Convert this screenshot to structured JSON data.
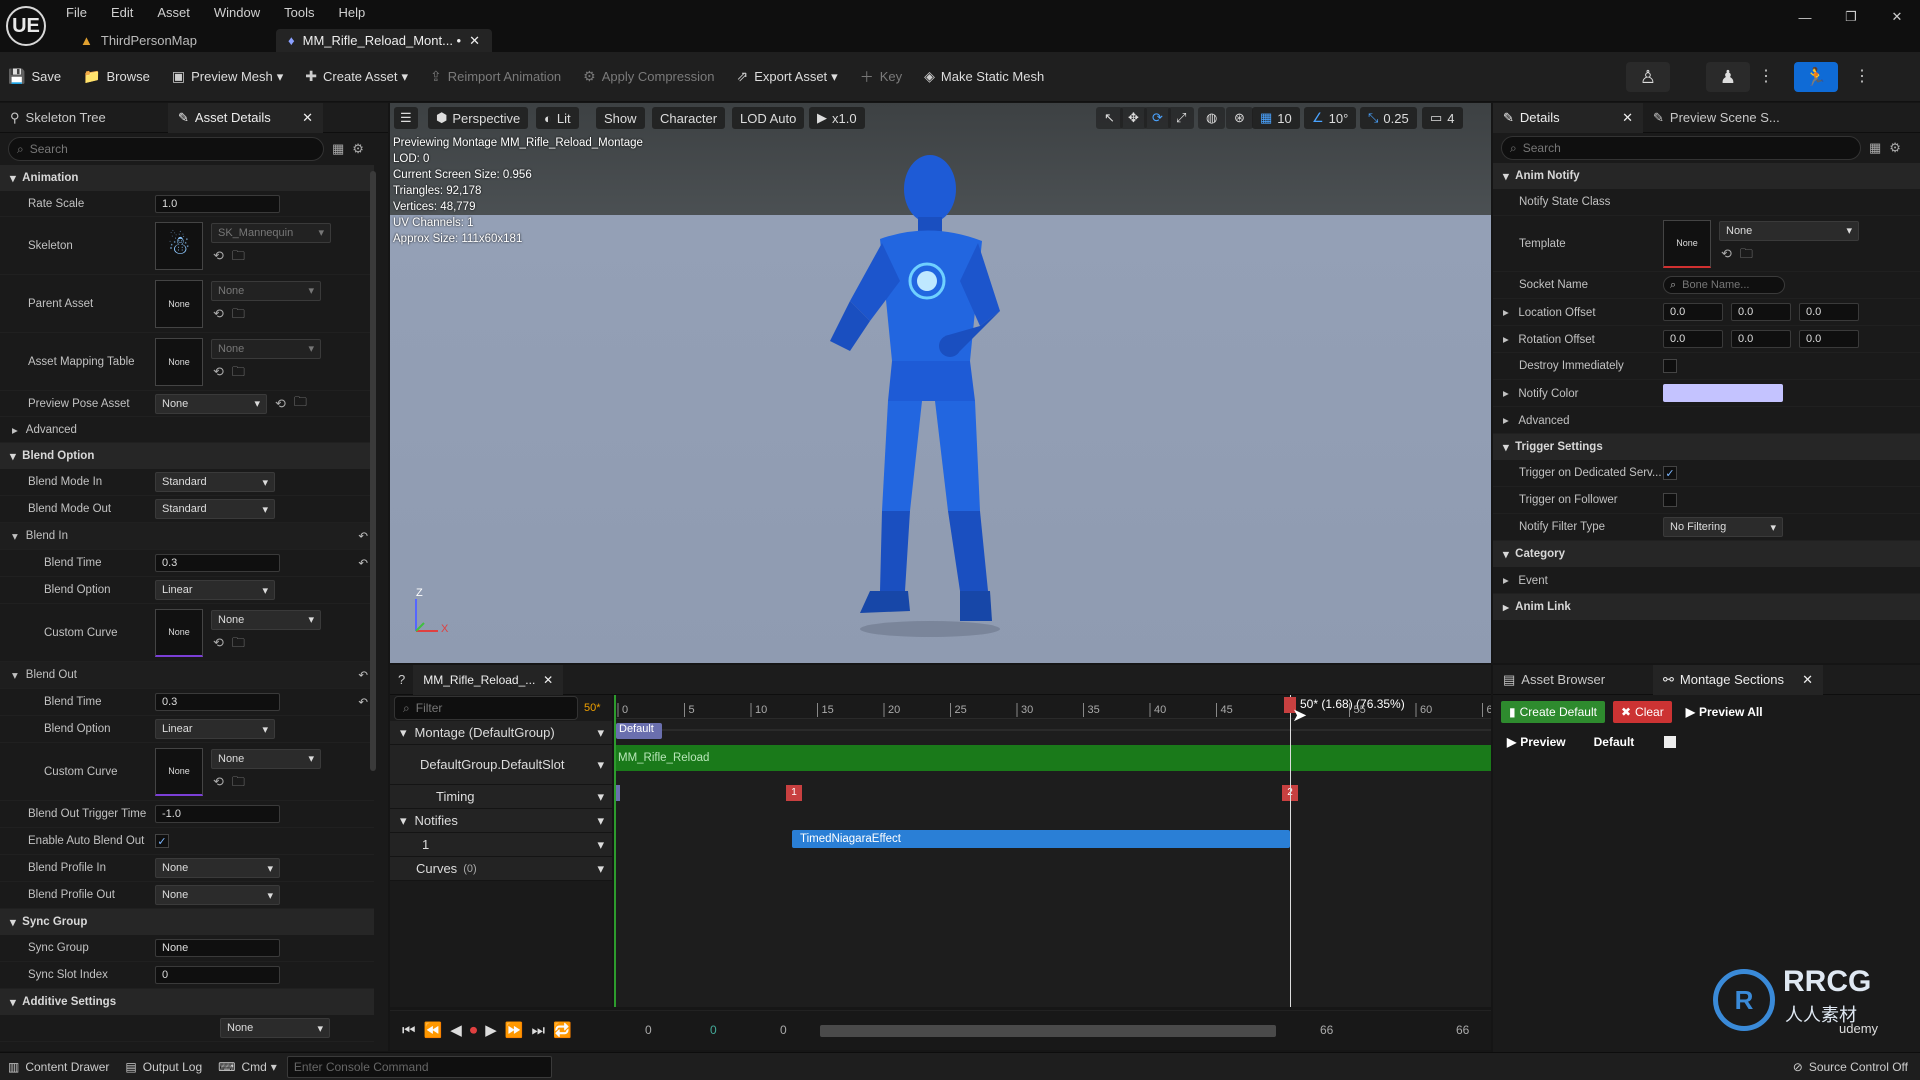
{
  "app": {
    "logo": "UE"
  },
  "menu": [
    "File",
    "Edit",
    "Asset",
    "Window",
    "Tools",
    "Help"
  ],
  "tabs": [
    {
      "label": "ThirdPersonMap",
      "icon": "map-icon"
    },
    {
      "label": "MM_Rifle_Reload_Mont... •",
      "icon": "montage-icon"
    }
  ],
  "toolbar": {
    "save": "Save",
    "browse": "Browse",
    "preview_mesh": "Preview Mesh",
    "create_asset": "Create Asset",
    "reimport": "Reimport Animation",
    "apply_compression": "Apply Compression",
    "export_asset": "Export Asset",
    "key": "Key",
    "make_static_mesh": "Make Static Mesh"
  },
  "left": {
    "tab1": "Skeleton Tree",
    "tab2": "Asset Details",
    "search_placeholder": "Search",
    "cat_animation": "Animation",
    "rate_scale_label": "Rate Scale",
    "rate_scale": "1.0",
    "skeleton_label": "Skeleton",
    "skeleton_value": "SK_Mannequin",
    "parent_asset_label": "Parent Asset",
    "none": "None",
    "asset_mapping_label": "Asset Mapping Table",
    "preview_pose_label": "Preview Pose Asset",
    "advanced": "Advanced",
    "cat_blend_option": "Blend Option",
    "blend_mode_in_label": "Blend Mode In",
    "blend_mode_in": "Standard",
    "blend_mode_out_label": "Blend Mode Out",
    "blend_mode_out": "Standard",
    "blend_in": "Blend In",
    "blend_time_label": "Blend Time",
    "blend_in_time": "0.3",
    "blend_option_label": "Blend Option",
    "blend_in_option": "Linear",
    "custom_curve_label": "Custom Curve",
    "blend_out": "Blend Out",
    "blend_out_time": "0.3",
    "blend_out_option": "Linear",
    "blend_out_trigger_label": "Blend Out Trigger Time",
    "blend_out_trigger": "-1.0",
    "enable_auto_label": "Enable Auto Blend Out",
    "blend_profile_in_label": "Blend Profile In",
    "blend_profile_out_label": "Blend Profile Out",
    "cat_sync_group": "Sync Group",
    "sync_group_label": "Sync Group",
    "sync_slot_label": "Sync Slot Index",
    "sync_slot": "0",
    "cat_additive": "Additive Settings"
  },
  "viewport": {
    "perspective": "Perspective",
    "lit": "Lit",
    "show": "Show",
    "character": "Character",
    "lod": "LOD Auto",
    "speed": "x1.0",
    "grid": "10",
    "angle": "10°",
    "scale": "0.25",
    "cam": "4",
    "info": [
      "Previewing Montage MM_Rifle_Reload_Montage",
      "LOD: 0",
      "Current Screen Size: 0.956",
      "Triangles: 92,178",
      "Vertices: 48,779",
      "UV Channels: 1",
      "Approx Size: 111x60x181"
    ],
    "axis_z": "Z",
    "axis_x": "X"
  },
  "timeline": {
    "tab": "MM_Rifle_Reload_...",
    "filter_placeholder": "Filter",
    "frame": "50*",
    "ticks": [
      "0",
      "5",
      "10",
      "15",
      "20",
      "25",
      "30",
      "35",
      "40",
      "45",
      "55",
      "60",
      "6"
    ],
    "playhead_label": "50* (1.68) (76.35%)",
    "montage": "Montage (DefaultGroup)",
    "default_section": "Default",
    "slot": "DefaultGroup.DefaultSlot",
    "slot_clip": "MM_Rifle_Reload",
    "timing": "Timing",
    "timing_markers": [
      "1",
      "2"
    ],
    "notifies": "Notifies",
    "notify_track": "1",
    "notify_name": "TimedNiagaraEffect",
    "curves": "Curves",
    "curves_count": "(0)",
    "bottom_vals": [
      "0",
      "0",
      "0",
      "66",
      "66"
    ]
  },
  "right": {
    "tab1": "Details",
    "tab2": "Preview Scene S...",
    "search_placeholder": "Search",
    "cat_anim_notify": "Anim Notify",
    "notify_state_class": "Notify State Class",
    "template_label": "Template",
    "none": "None",
    "socket_label": "Socket Name",
    "socket_placeholder": "Bone Name...",
    "location_label": "Location Offset",
    "rotation_label": "Rotation Offset",
    "zero": "0.0",
    "destroy_label": "Destroy Immediately",
    "notify_color_label": "Notify Color",
    "notify_color": "#c4c3ff",
    "advanced": "Advanced",
    "cat_trigger": "Trigger Settings",
    "trigger_dedicated": "Trigger on Dedicated Serv...",
    "trigger_follower": "Trigger on Follower",
    "filter_type_label": "Notify Filter Type",
    "filter_type": "No Filtering",
    "cat_category": "Category",
    "event": "Event",
    "cat_anim_link": "Anim Link"
  },
  "sections": {
    "tab1": "Asset Browser",
    "tab2": "Montage Sections",
    "create_default": "Create Default",
    "clear": "Clear",
    "preview_all": "Preview All",
    "preview": "Preview",
    "default": "Default"
  },
  "bottom": {
    "content_drawer": "Content Drawer",
    "output_log": "Output Log",
    "cmd": "Cmd",
    "console_placeholder": "Enter Console Command",
    "source_control": "Source Control Off"
  },
  "watermark": {
    "brand": "RRCG",
    "sub": "人人素材",
    "udemy": "udemy"
  }
}
